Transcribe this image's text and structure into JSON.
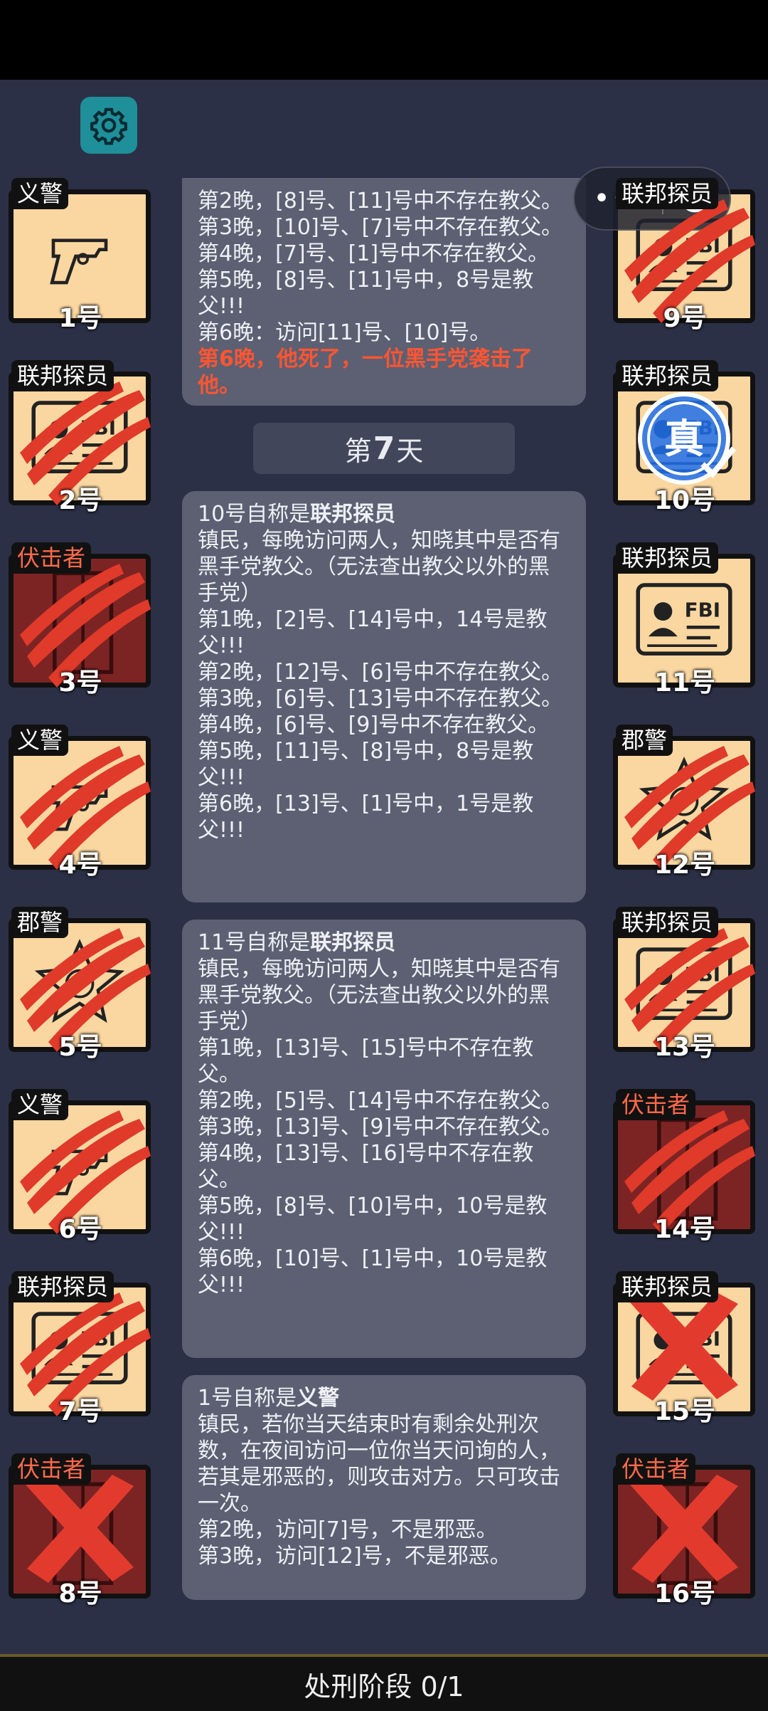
{
  "header": {
    "settings_icon": "gear-icon",
    "menu_icon": "more-dots-icon",
    "close_icon": "target-close-icon"
  },
  "players_left": [
    {
      "num": "1号",
      "role": "义警",
      "bg": "light",
      "art": "gun",
      "overlay": "none"
    },
    {
      "num": "2号",
      "role": "联邦探员",
      "bg": "light",
      "art": "fbi",
      "overlay": "claw"
    },
    {
      "num": "3号",
      "role": "伏击者",
      "bg": "red",
      "art": "door",
      "overlay": "claw"
    },
    {
      "num": "4号",
      "role": "义警",
      "bg": "light",
      "art": "gun",
      "overlay": "claw"
    },
    {
      "num": "5号",
      "role": "郡警",
      "bg": "light",
      "art": "badge",
      "overlay": "claw"
    },
    {
      "num": "6号",
      "role": "义警",
      "bg": "light",
      "art": "gun",
      "overlay": "claw"
    },
    {
      "num": "7号",
      "role": "联邦探员",
      "bg": "light",
      "art": "fbi",
      "overlay": "claw"
    },
    {
      "num": "8号",
      "role": "伏击者",
      "bg": "red",
      "art": "door",
      "overlay": "x"
    }
  ],
  "players_right": [
    {
      "num": "9号",
      "role": "联邦探员",
      "bg": "light",
      "art": "fbi",
      "overlay": "claw"
    },
    {
      "num": "10号",
      "role": "联邦探员",
      "bg": "light",
      "art": "fbi",
      "overlay": "true"
    },
    {
      "num": "11号",
      "role": "联邦探员",
      "bg": "light",
      "art": "fbi",
      "overlay": "none"
    },
    {
      "num": "12号",
      "role": "郡警",
      "bg": "light",
      "art": "badge",
      "overlay": "claw"
    },
    {
      "num": "13号",
      "role": "联邦探员",
      "bg": "light",
      "art": "fbi",
      "overlay": "claw"
    },
    {
      "num": "14号",
      "role": "伏击者",
      "bg": "red",
      "art": "door",
      "overlay": "claw"
    },
    {
      "num": "15号",
      "role": "联邦探员",
      "bg": "light",
      "art": "fbi",
      "overlay": "x"
    },
    {
      "num": "16号",
      "role": "伏击者",
      "bg": "red",
      "art": "door",
      "overlay": "x"
    }
  ],
  "true_stamp_text": "真",
  "fbi_text": "FBI",
  "messages": {
    "first": {
      "lines": [
        "第2晚，[8]号、[11]号中不存在教父。",
        "第3晚，[10]号、[7]号中不存在教父。",
        "第4晚，[7]号、[1]号中不存在教父。",
        "第5晚，[8]号、[11]号中，8号是教父!!!",
        "第6晚：访问[11]号、[10]号。"
      ],
      "death": "第6晚，他死了，一位黑手党袭击了他。"
    },
    "day_prefix": "第",
    "day_number": "7",
    "day_suffix": "天",
    "claim10": {
      "claim_prefix": "10号自称是",
      "claim_role": "联邦探员",
      "lines": [
        "镇民，每晚访问两人，知晓其中是否有黑手党教父。（无法查出教父以外的黑手党）",
        "第1晚，[2]号、[14]号中，14号是教父!!!",
        "第2晚，[12]号、[6]号中不存在教父。",
        "第3晚，[6]号、[13]号中不存在教父。",
        "第4晚，[6]号、[9]号中不存在教父。",
        "第5晚，[11]号、[8]号中，8号是教父!!!",
        "第6晚，[13]号、[1]号中，1号是教父!!!"
      ]
    },
    "claim11": {
      "claim_prefix": "11号自称是",
      "claim_role": "联邦探员",
      "lines": [
        "镇民，每晚访问两人，知晓其中是否有黑手党教父。（无法查出教父以外的黑手党）",
        "第1晚，[13]号、[15]号中不存在教父。",
        "第2晚，[5]号、[14]号中不存在教父。",
        "第3晚，[13]号、[9]号中不存在教父。",
        "第4晚，[13]号、[16]号中不存在教父。",
        "第5晚，[8]号、[10]号中，10号是教父!!!",
        "第6晚，[10]号、[1]号中，10号是教父!!!"
      ]
    },
    "claim1": {
      "claim_prefix": "1号自称是",
      "claim_role": "义警",
      "lines": [
        "镇民，若你当天结束时有剩余处刑次数，在夜间访问一位你当天问询的人，若其是邪恶的，则攻击对方。只可攻击一次。",
        "第2晚，访问[7]号，不是邪恶。",
        "第3晚，访问[12]号，不是邪恶。"
      ]
    }
  },
  "footer": {
    "phase_label": "处刑阶段 0/1"
  },
  "colors": {
    "background": "#2b3046",
    "card": "#5c6072",
    "accent_red": "#ff5533",
    "tile": "#fad7a0",
    "tile_red": "#7c2424"
  }
}
